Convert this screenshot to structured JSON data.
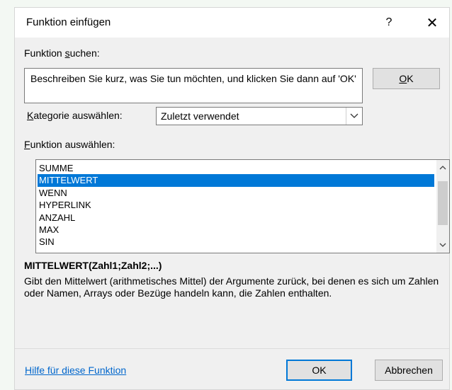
{
  "dialog": {
    "title": "Funktion einfügen",
    "help_glyph": "?",
    "close_glyph": "✕"
  },
  "search": {
    "label_pre": "Funktion ",
    "label_u": "s",
    "label_post": "uchen:",
    "text": "Beschreiben Sie kurz, was Sie tun möchten, und klicken Sie dann auf 'OK'",
    "go_pre": "",
    "go_u": "O",
    "go_post": "K"
  },
  "category": {
    "label_u": "K",
    "label_post": "ategorie auswählen:",
    "selected": "Zuletzt verwendet",
    "arrow_icon": "chevron-down-icon"
  },
  "functions": {
    "label_u": "F",
    "label_post": "unktion auswählen:",
    "items": [
      "SUMME",
      "MITTELWERT",
      "WENN",
      "HYPERLINK",
      "ANZAHL",
      "MAX",
      "SIN"
    ],
    "selected_index": 1
  },
  "details": {
    "signature": "MITTELWERT(Zahl1;Zahl2;...)",
    "description": "Gibt den Mittelwert (arithmetisches Mittel) der Argumente zurück, bei denen es sich um Zahlen oder Namen, Arrays oder Bezüge handeln kann, die Zahlen enthalten."
  },
  "footer": {
    "help_link": "Hilfe für diese Funktion",
    "ok": "OK",
    "cancel": "Abbrechen"
  },
  "colors": {
    "selection": "#0078d7",
    "link": "#0066cc"
  }
}
